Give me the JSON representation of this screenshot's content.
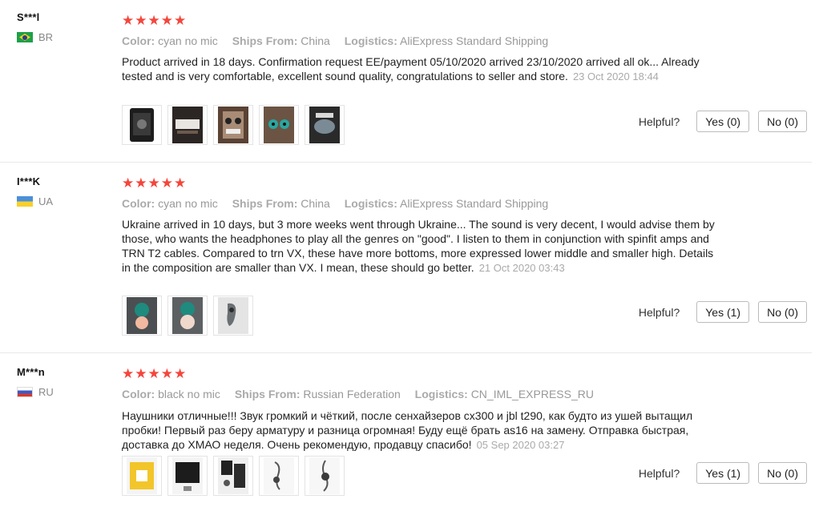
{
  "labels": {
    "color": "Color:",
    "ships_from": "Ships From:",
    "logistics": "Logistics:",
    "helpful": "Helpful?"
  },
  "reviews": [
    {
      "user": "S***l",
      "country": "BR",
      "stars": "★★★★★",
      "color": "cyan no mic",
      "ships_from": "China",
      "logistics": "AliExpress Standard Shipping",
      "text": "Product arrived in 18 days. Confirmation request EE/payment 05/10/2020 arrived 23/10/2020 arrived all ok... Already tested and is very comfortable, excellent sound quality, congratulations to seller and store.",
      "date": "23 Oct 2020 18:44",
      "yes": "Yes (0)",
      "no": "No (0)",
      "photos": [
        "photo-1",
        "photo-2",
        "photo-3",
        "photo-4",
        "photo-5"
      ]
    },
    {
      "user": "I***K",
      "country": "UA",
      "stars": "★★★★★",
      "color": "cyan no mic",
      "ships_from": "China",
      "logistics": "AliExpress Standard Shipping",
      "text": "Ukraine arrived in 10 days, but 3 more weeks went through Ukraine... The sound is very decent, I would advise them by those, who wants the headphones to play all the genres on \"good\". I listen to them in conjunction with spinfit amps and TRN T2 cables. Compared to trn VX, these have more bottoms, more expressed lower middle and smaller high. Details in the composition are smaller than VX. I mean, these should go better.",
      "date": "21 Oct 2020 03:43",
      "yes": "Yes (1)",
      "no": "No (0)",
      "photos": [
        "photo-1",
        "photo-2",
        "photo-3"
      ]
    },
    {
      "user": "M***n",
      "country": "RU",
      "stars": "★★★★★",
      "color": "black no mic",
      "ships_from": "Russian Federation",
      "logistics": "CN_IML_EXPRESS_RU",
      "text": "Наушники отличные!!! Звук громкий и чёткий, после сенхайзеров cx300 и jbl t290, как будто из ушей вытащил пробки! Первый раз беру арматуру и разница огромная! Буду ещё брать as16 на замену. Отправка быстрая, доставка до ХМАО неделя. Очень рекомендую, продавцу спасибо!",
      "date": "05 Sep 2020 03:27",
      "yes": "Yes (1)",
      "no": "No (0)",
      "photos": [
        "photo-1",
        "photo-2",
        "photo-3",
        "photo-4",
        "photo-5"
      ]
    }
  ]
}
